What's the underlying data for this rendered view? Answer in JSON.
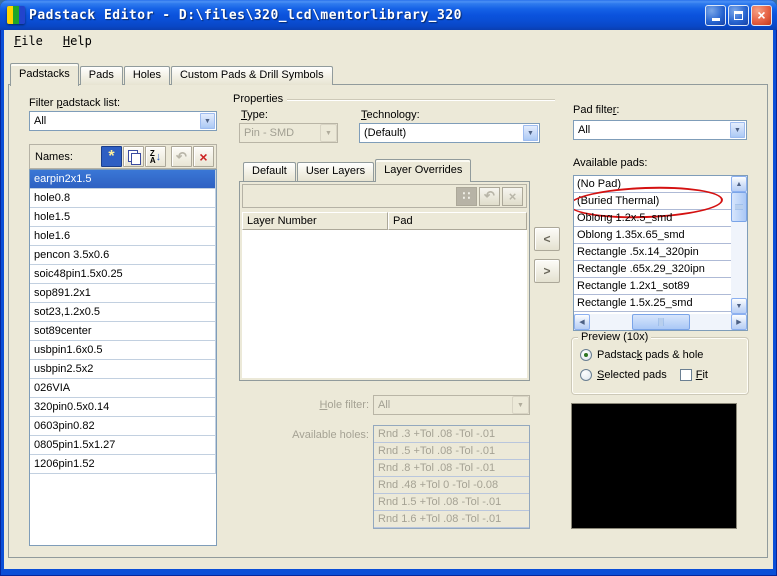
{
  "window": {
    "title": "Padstack Editor - D:\\files\\320_lcd\\mentorlibrary_320"
  },
  "menu": {
    "file": {
      "u": "F",
      "post": "ile"
    },
    "help": {
      "u": "H",
      "post": "elp"
    }
  },
  "tabs": {
    "items": [
      "Padstacks",
      "Pads",
      "Holes",
      "Custom Pads & Drill Symbols"
    ],
    "active": 0
  },
  "left": {
    "filter_label": {
      "pre": "Filter ",
      "u": "p",
      "post": "adstack list:"
    },
    "filter_value": "All",
    "names_label": "Names:",
    "names": [
      "earpin2x1.5",
      "hole0.8",
      "hole1.5",
      "hole1.6",
      "pencon 3.5x0.6",
      "soic48pin1.5x0.25",
      "sop891.2x1",
      "sot23,1.2x0.5",
      "sot89center",
      "usbpin1.6x0.5",
      "usbpin2.5x2",
      "026VIA",
      "320pin0.5x0.14",
      "0603pin0.82",
      "0805pin1.5x1.27",
      "1206pin1.52"
    ],
    "selected_index": 0
  },
  "properties": {
    "title": "Properties",
    "type_label": {
      "u": "T",
      "post": "ype:"
    },
    "type_value": "Pin - SMD",
    "tech_label": {
      "u": "T",
      "post": "echnology:"
    },
    "tech_value": "(Default)",
    "tabs": {
      "items": [
        "Default",
        "User Layers",
        "Layer Overrides"
      ],
      "active": 2
    },
    "table": {
      "columns": [
        "Layer Number",
        "Pad"
      ],
      "rows": []
    },
    "hole_filter_label": {
      "u": "H",
      "post": "ole filter:"
    },
    "hole_filter_value": "All",
    "holes_label": "Available holes:",
    "holes": [
      "Rnd .3 +Tol .08 -Tol -.01",
      "Rnd .5 +Tol .08 -Tol -.01",
      "Rnd .8 +Tol .08 -Tol -.01",
      "Rnd .48 +Tol 0 -Tol -0.08",
      "Rnd 1.5 +Tol .08 -Tol -.01",
      "Rnd 1.6 +Tol .08 -Tol -.01"
    ]
  },
  "pads": {
    "filter_label": {
      "pre": "Pad filte",
      "u": "r",
      "post": ":"
    },
    "filter_value": "All",
    "available_label": "Available pads:",
    "items": [
      "(No Pad)",
      "(Buried Thermal)",
      "Oblong 1.2x.5_smd",
      "Oblong 1.35x.65_smd",
      "Rectangle .5x.14_320pin",
      "Rectangle .65x.29_320ipn",
      "Rectangle 1.2x1_sot89",
      "Rectangle 1.5x.25_smd"
    ],
    "annotated_index": 1,
    "annotation": {
      "type": "ellipse",
      "color": "#d41111",
      "target": "(Buried Thermal)"
    }
  },
  "preview": {
    "title": "Preview (10x)",
    "radio1": {
      "pre": "Padstac",
      "u": "k",
      "post": " pads & hole"
    },
    "radio2": {
      "u": "S",
      "post": "elected pads"
    },
    "fit": {
      "u": "F",
      "post": "it"
    },
    "selected_radio": 0,
    "fit_checked": false
  },
  "icons": {
    "new": "*",
    "sort_top": "Z",
    "sort_bottom": "A",
    "sort_arrow": "↓",
    "undo": "↶",
    "delete": "×",
    "grid": "∷",
    "combo_arrow": "▼",
    "scroll_up": "▲",
    "scroll_down": "▼",
    "scroll_left": "◀",
    "scroll_right": "▶",
    "move_left": "<",
    "move_right": ">",
    "close": "×"
  },
  "colors": {
    "selection": "#316ac5",
    "annotation": "#d41111",
    "titlebar": "#0b53dd",
    "client_bg": "#ece9d8"
  }
}
